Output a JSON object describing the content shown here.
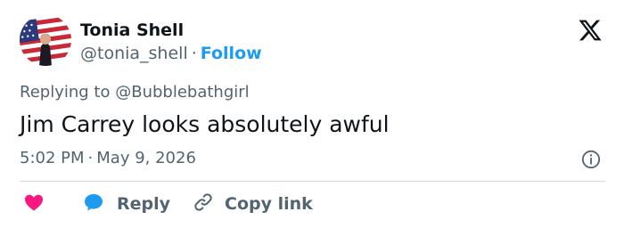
{
  "author": {
    "display_name": "Tonia Shell",
    "handle": "@tonia_shell",
    "separator": "·",
    "follow_label": "Follow",
    "avatar_icon": "avatar-american-flag"
  },
  "brand": {
    "logo_icon": "x-logo-icon"
  },
  "tweet": {
    "replying_prefix": "Replying to",
    "replying_to": "@Bubblebathgirl",
    "text": "Jim Carrey looks absolutely awful",
    "time": "5:02 PM",
    "date": "May 9, 2026",
    "separator": "·"
  },
  "actions": {
    "like_icon": "heart-icon",
    "reply_icon": "speech-bubble-icon",
    "reply_label": "Reply",
    "copy_icon": "link-icon",
    "copy_label": "Copy link"
  },
  "colors": {
    "text": "#0f1419",
    "secondary": "#536471",
    "accent": "#1d9bf0",
    "like": "#f91880",
    "divider": "#cfd9de"
  }
}
